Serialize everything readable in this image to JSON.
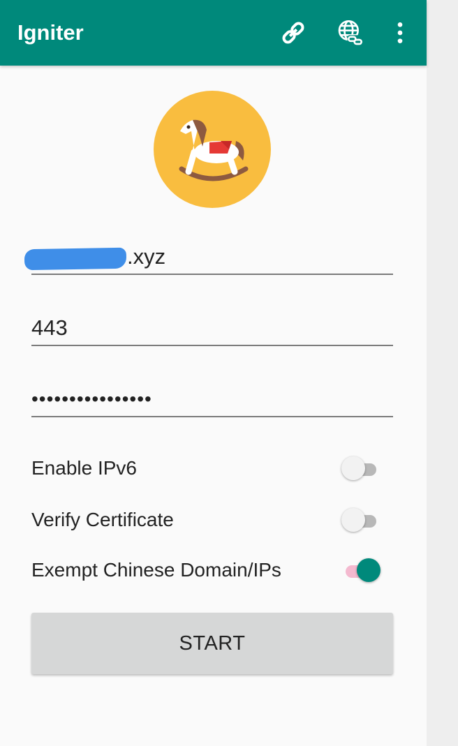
{
  "app": {
    "title": "Igniter",
    "theme_color": "#00897b",
    "actions": [
      {
        "icon": "link-icon"
      },
      {
        "icon": "globe-link-icon"
      },
      {
        "icon": "more-vert-icon"
      }
    ]
  },
  "logo": {
    "icon": "rocking-horse-icon",
    "background": "#f9bd3f"
  },
  "form": {
    "server_address": {
      "value_suffix": ".xyz",
      "redacted": true
    },
    "port": {
      "value": "443"
    },
    "password": {
      "masked_value": "••••••••••••••••"
    }
  },
  "options": [
    {
      "label": "Enable IPv6",
      "enabled": false
    },
    {
      "label": "Verify Certificate",
      "enabled": false
    },
    {
      "label": "Exempt Chinese Domain/IPs",
      "enabled": true
    }
  ],
  "start_button": {
    "label": "START"
  }
}
